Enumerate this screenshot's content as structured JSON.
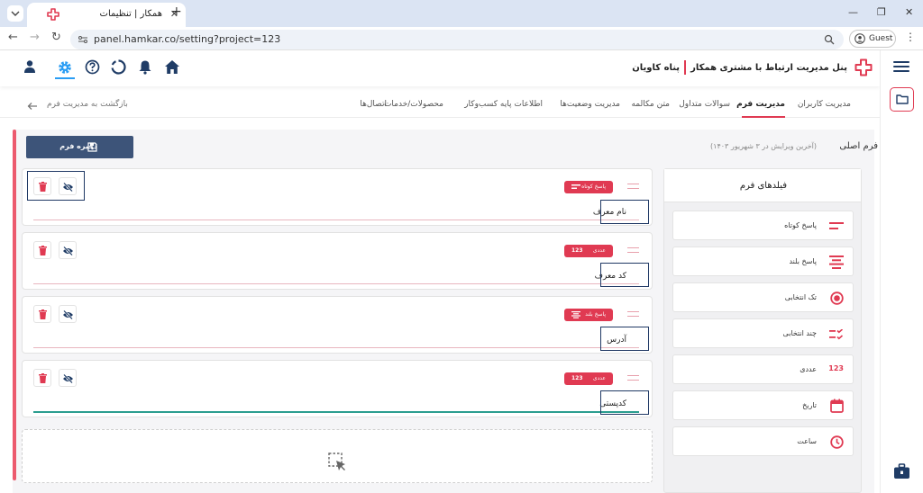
{
  "browser": {
    "tab_title": "همکار | تنظیمات",
    "url": "panel.hamkar.co/setting?project=123",
    "profile_label": "Guest",
    "new_tab_glyph": "+",
    "close_glyph": "✕"
  },
  "header": {
    "brand_name": "پنل مدیریت ارتباط با مشتری همکار",
    "user_name": "پناه کاویان",
    "icons": [
      "user-icon",
      "settings-icon",
      "help-icon",
      "loading-icon",
      "bell-icon",
      "home-icon"
    ],
    "active_icon": "settings-icon",
    "accent_color": "#e03a52"
  },
  "tabs": [
    {
      "label": "مدیریت کاربران",
      "active": false
    },
    {
      "label": "مدیریت فرم",
      "active": true
    },
    {
      "label": "سوالات متداول",
      "active": false
    },
    {
      "label": "متن مکالمه",
      "active": false
    },
    {
      "label": "مدیریت وضعیت‌ها",
      "active": false
    },
    {
      "label": "اطلاعات پایه کسب‌وکار",
      "active": false
    },
    {
      "label": "محصولات/خدمات",
      "active": false
    },
    {
      "label": "اتصال‌ها",
      "active": false
    }
  ],
  "back_link": "بازگشت به مدیریت فرم",
  "form": {
    "title": "فرم اصلی",
    "subtitle": "(آخرین ویرایش در ۳ شهریور ۱۴۰۳)",
    "save_label": "ذخیره فرم",
    "fields": [
      {
        "label": "نام معرف",
        "type_label": "پاسخ کوتاه",
        "type_icon": "short-answer-icon"
      },
      {
        "label": "کد معرف",
        "type_label": "عددی",
        "type_icon": "number-icon",
        "type_glyph": "123"
      },
      {
        "label": "آدرس",
        "type_label": "پاسخ بلند",
        "type_icon": "long-answer-icon"
      },
      {
        "label": "کدپستی",
        "type_label": "عددی",
        "type_icon": "number-icon",
        "type_glyph": "123"
      }
    ]
  },
  "palette": {
    "title": "فیلدهای فرم",
    "items": [
      {
        "label": "پاسخ کوتاه",
        "icon": "short-answer-icon"
      },
      {
        "label": "پاسخ بلند",
        "icon": "long-answer-icon"
      },
      {
        "label": "تک انتخابی",
        "icon": "radio-icon"
      },
      {
        "label": "چند انتخابی",
        "icon": "checklist-icon"
      },
      {
        "label": "عددی",
        "icon": "number-icon",
        "glyph": "123"
      },
      {
        "label": "تاریخ",
        "icon": "calendar-icon"
      },
      {
        "label": "ساعت",
        "icon": "clock-icon"
      }
    ]
  }
}
